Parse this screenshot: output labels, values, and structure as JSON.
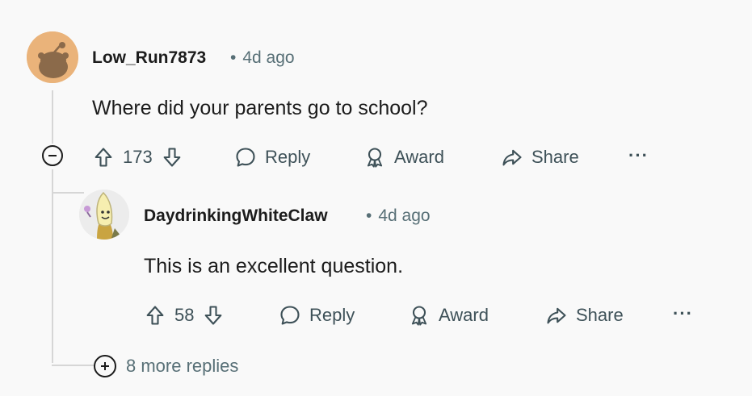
{
  "comment": {
    "username": "Low_Run7873",
    "time": "4d ago",
    "text": "Where did your parents go to school?",
    "votes": "173",
    "reply_label": "Reply",
    "award_label": "Award",
    "share_label": "Share",
    "avatar_color": "#eab37a"
  },
  "reply": {
    "username": "DaydrinkingWhiteClaw",
    "time": "4d ago",
    "text": "This is an excellent question.",
    "votes": "58",
    "reply_label": "Reply",
    "award_label": "Award",
    "share_label": "Share"
  },
  "more_replies_label": "8 more replies",
  "meta_separator": "•",
  "overflow_label": "···"
}
